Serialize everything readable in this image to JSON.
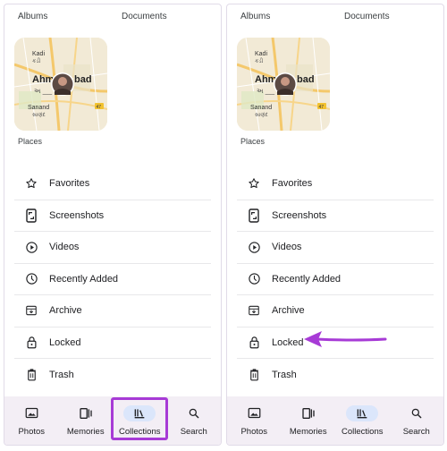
{
  "panels": [
    {
      "id": "left",
      "top": {
        "albums": "Albums",
        "documents": "Documents"
      },
      "map": {
        "city_part1": "Ahm",
        "city_part2": "bad",
        "script_text": "અ ___ ાદ",
        "kadi": "Kadi",
        "kadi_script": "કડી",
        "sanand": "Sanand",
        "sanand_script": "સાણંદ",
        "road_num": "47"
      },
      "places_label": "Places",
      "list": [
        {
          "label": "Favorites",
          "icon": "star-icon"
        },
        {
          "label": "Screenshots",
          "icon": "phone-screenshot-icon"
        },
        {
          "label": "Videos",
          "icon": "play-circle-icon"
        },
        {
          "label": "Recently Added",
          "icon": "clock-icon"
        },
        {
          "label": "Archive",
          "icon": "archive-icon"
        },
        {
          "label": "Locked",
          "icon": "lock-icon"
        },
        {
          "label": "Trash",
          "icon": "trash-icon"
        }
      ],
      "nav": [
        {
          "label": "Photos",
          "icon": "photo-icon"
        },
        {
          "label": "Memories",
          "icon": "memories-icon"
        },
        {
          "label": "Collections",
          "icon": "collections-icon",
          "active": true
        },
        {
          "label": "Search",
          "icon": "search-icon"
        }
      ]
    },
    {
      "id": "right",
      "top": {
        "albums": "Albums",
        "documents": "Documents"
      },
      "map": {
        "city_part1": "Ahm",
        "city_part2": "bad",
        "script_text": "અ ___ ાદ",
        "kadi": "Kadi",
        "kadi_script": "કડી",
        "sanand": "Sanand",
        "sanand_script": "સાણંદ",
        "road_num": "47"
      },
      "places_label": "Places",
      "list": [
        {
          "label": "Favorites",
          "icon": "star-icon"
        },
        {
          "label": "Screenshots",
          "icon": "phone-screenshot-icon"
        },
        {
          "label": "Videos",
          "icon": "play-circle-icon"
        },
        {
          "label": "Recently Added",
          "icon": "clock-icon"
        },
        {
          "label": "Archive",
          "icon": "archive-icon"
        },
        {
          "label": "Locked",
          "icon": "lock-icon"
        },
        {
          "label": "Trash",
          "icon": "trash-icon"
        }
      ],
      "nav": [
        {
          "label": "Photos",
          "icon": "photo-icon"
        },
        {
          "label": "Memories",
          "icon": "memories-icon"
        },
        {
          "label": "Collections",
          "icon": "collections-icon",
          "active": true
        },
        {
          "label": "Search",
          "icon": "search-icon"
        }
      ]
    }
  ],
  "annotations": {
    "highlight_color": "#a73bd6",
    "arrow_color": "#a73bd6"
  }
}
